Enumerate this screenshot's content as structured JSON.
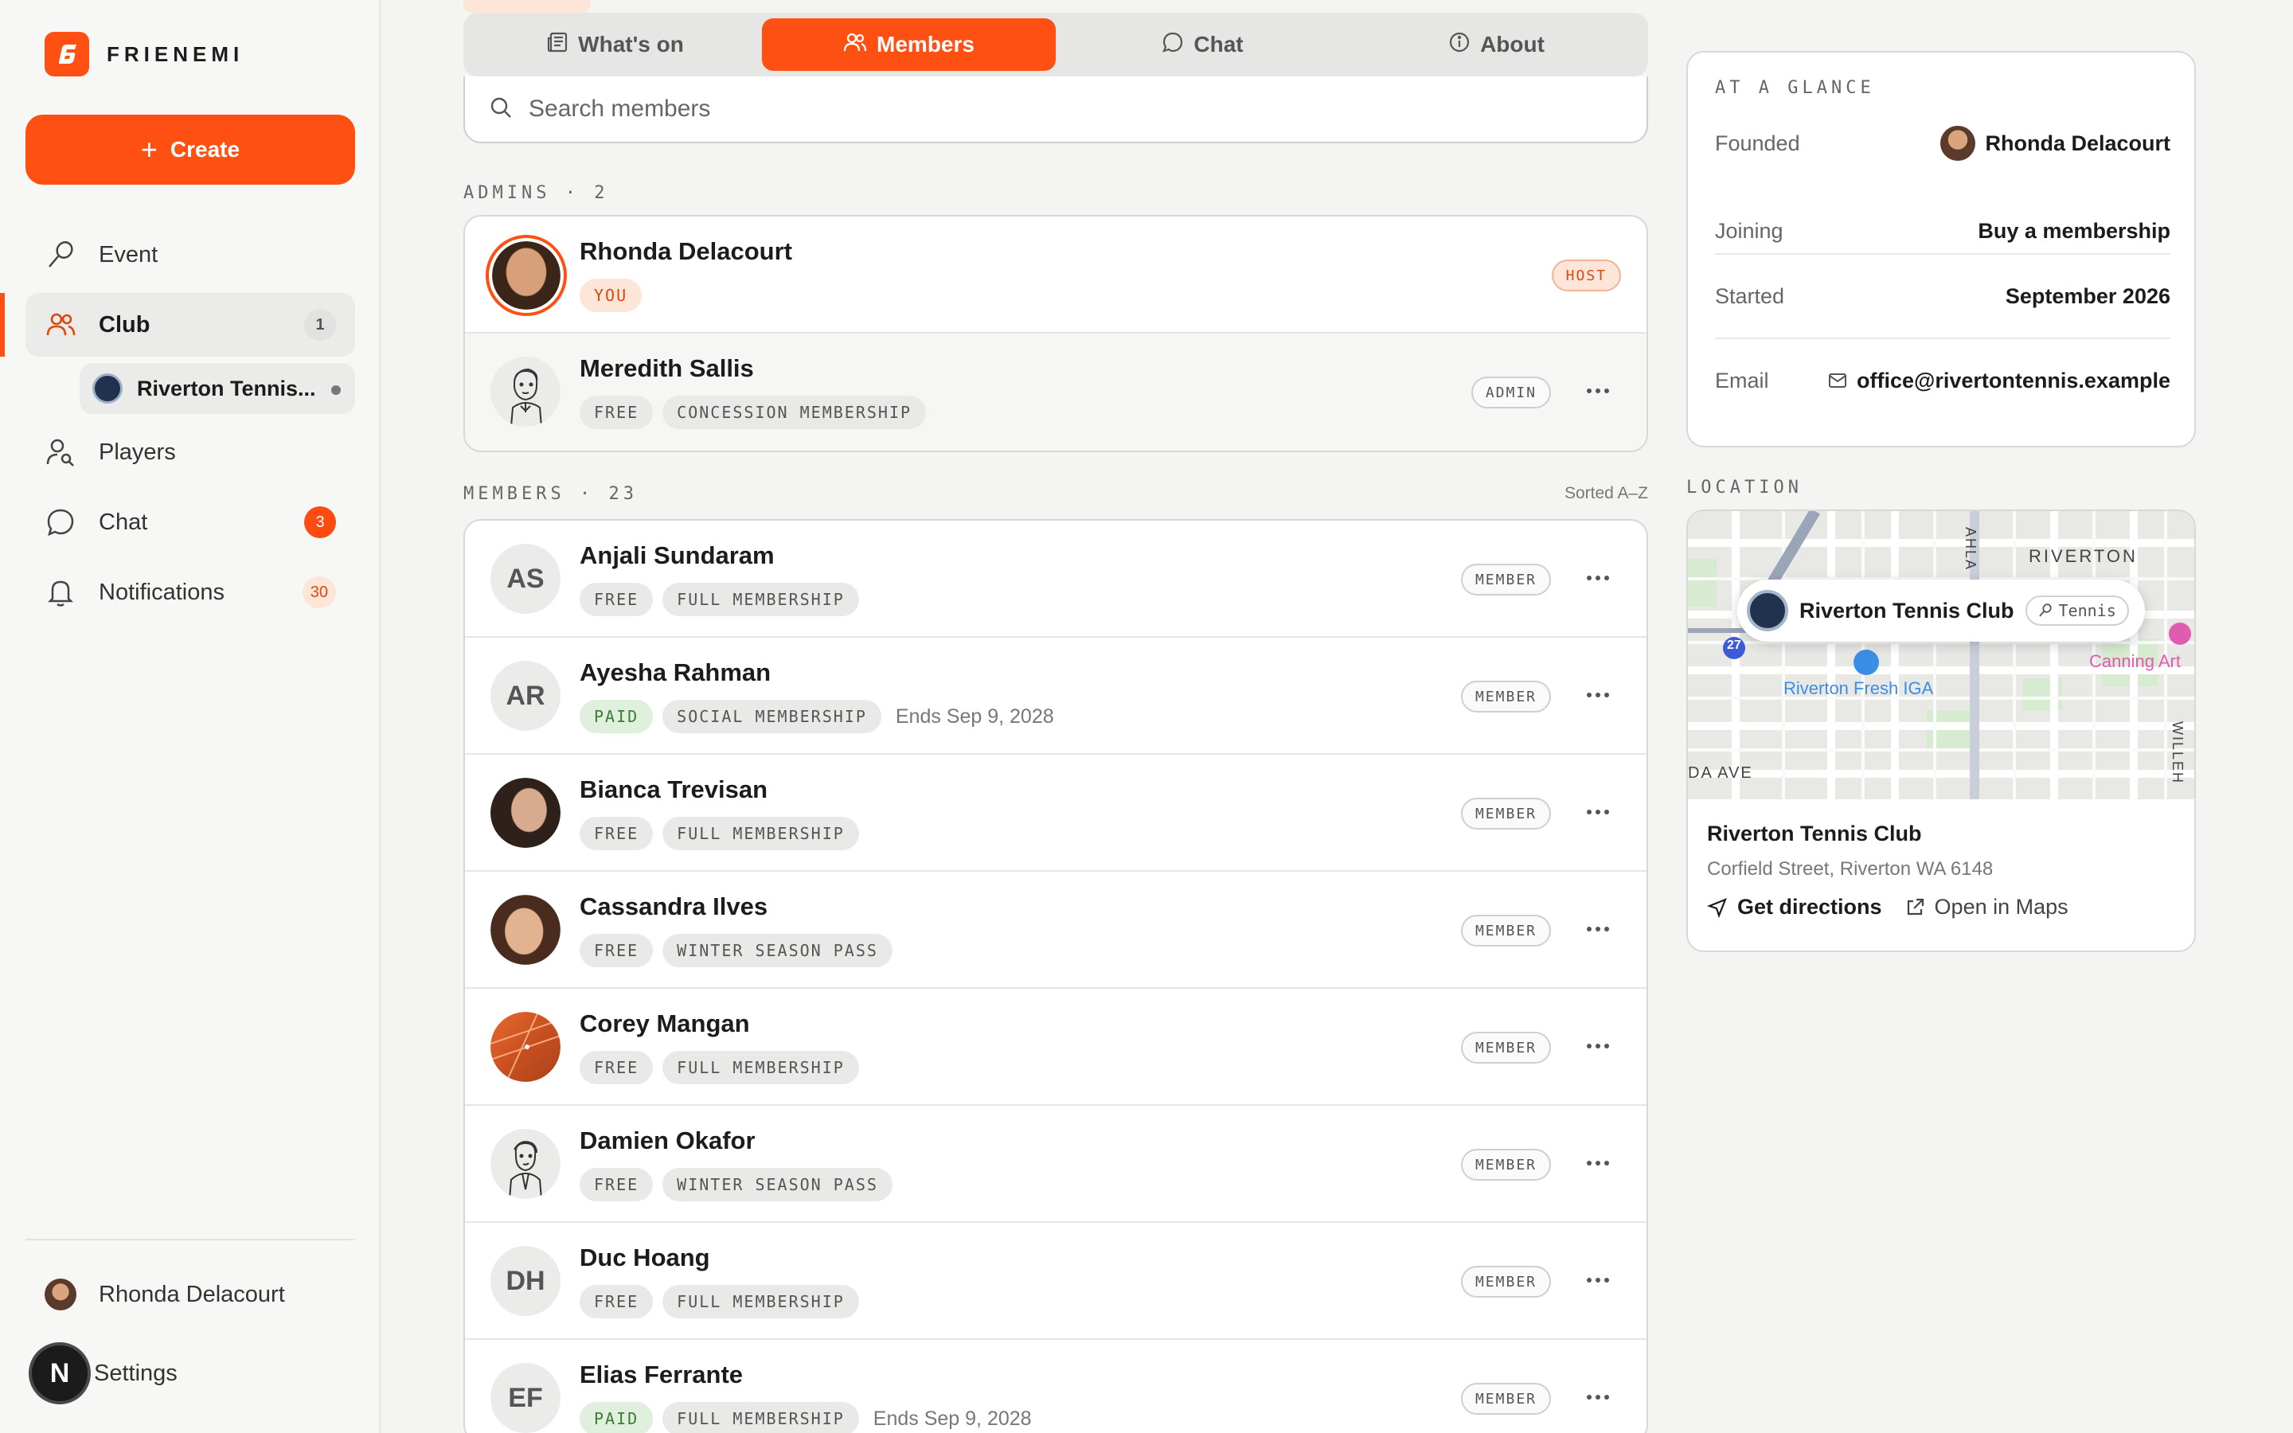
{
  "app": {
    "name": "FRIENEMI",
    "create_label": "Create"
  },
  "sidebar": {
    "items": [
      {
        "label": "Event",
        "icon": "racket-icon"
      },
      {
        "label": "Club",
        "icon": "users-icon",
        "badge": "1"
      },
      {
        "label": "Players",
        "icon": "user-search-icon"
      },
      {
        "label": "Chat",
        "icon": "chat-icon",
        "badge": "3"
      },
      {
        "label": "Notifications",
        "icon": "bell-icon",
        "badge": "30"
      }
    ],
    "sub_item": {
      "label": "Riverton Tennis..."
    },
    "user_name": "Rhonda Delacourt",
    "settings_label": "Settings",
    "n_label": "N"
  },
  "tabs": [
    {
      "label": "What's on",
      "icon": "newspaper-icon"
    },
    {
      "label": "Members",
      "icon": "users-icon",
      "active": true
    },
    {
      "label": "Chat",
      "icon": "chat-icon"
    },
    {
      "label": "About",
      "icon": "info-icon"
    }
  ],
  "search": {
    "placeholder": "Search members"
  },
  "admins": {
    "label": "ADMINS · 2",
    "rows": [
      {
        "name": "Rhonda Delacourt",
        "tags": [
          "YOU"
        ],
        "role": "HOST"
      },
      {
        "name": "Meredith Sallis",
        "tags": [
          "FREE",
          "CONCESSION MEMBERSHIP"
        ],
        "role": "ADMIN"
      }
    ]
  },
  "members": {
    "label": "MEMBERS · 23",
    "sort_label": "Sorted A–Z",
    "rows": [
      {
        "name": "Anjali Sundaram",
        "initials": "AS",
        "tags": [
          "FREE",
          "FULL MEMBERSHIP"
        ],
        "role": "MEMBER"
      },
      {
        "name": "Ayesha Rahman",
        "initials": "AR",
        "tags": [
          "PAID",
          "SOCIAL MEMBERSHIP"
        ],
        "ends": "Ends Sep 9, 2028",
        "role": "MEMBER"
      },
      {
        "name": "Bianca Trevisan",
        "tags": [
          "FREE",
          "FULL MEMBERSHIP"
        ],
        "role": "MEMBER"
      },
      {
        "name": "Cassandra Ilves",
        "tags": [
          "FREE",
          "WINTER SEASON PASS"
        ],
        "role": "MEMBER"
      },
      {
        "name": "Corey Mangan",
        "tags": [
          "FREE",
          "FULL MEMBERSHIP"
        ],
        "role": "MEMBER"
      },
      {
        "name": "Damien Okafor",
        "tags": [
          "FREE",
          "WINTER SEASON PASS"
        ],
        "role": "MEMBER"
      },
      {
        "name": "Duc Hoang",
        "initials": "DH",
        "tags": [
          "FREE",
          "FULL MEMBERSHIP"
        ],
        "role": "MEMBER"
      },
      {
        "name": "Elias Ferrante",
        "initials": "EF",
        "tags": [
          "PAID",
          "FULL MEMBERSHIP"
        ],
        "ends": "Ends Sep 9, 2028",
        "role": "MEMBER"
      }
    ]
  },
  "glance": {
    "title": "AT A GLANCE",
    "rows": [
      {
        "key": "Founded",
        "value": "Rhonda Delacourt"
      },
      {
        "key": "Joining",
        "value": "Buy a membership"
      },
      {
        "key": "Started",
        "value": "September 2026"
      },
      {
        "key": "Email",
        "value": "office@rivertontennis.example"
      }
    ]
  },
  "location": {
    "title": "LOCATION",
    "club_name": "Riverton Tennis Club",
    "sport": "Tennis",
    "address": "Corfield Street, Riverton WA 6148",
    "get_directions": "Get directions",
    "open_maps": "Open in Maps",
    "map_labels": {
      "riverton": "RIVERTON",
      "shop": "Riverton Fresh IGA",
      "arts": "Canning Art",
      "ave": "DA AVE",
      "road_top": "AHLA",
      "road_right": "WILLEH",
      "route": "27"
    }
  },
  "colors": {
    "accent": "#ff5014",
    "paid": "#3d7a35",
    "peach": "#fde5d8"
  }
}
